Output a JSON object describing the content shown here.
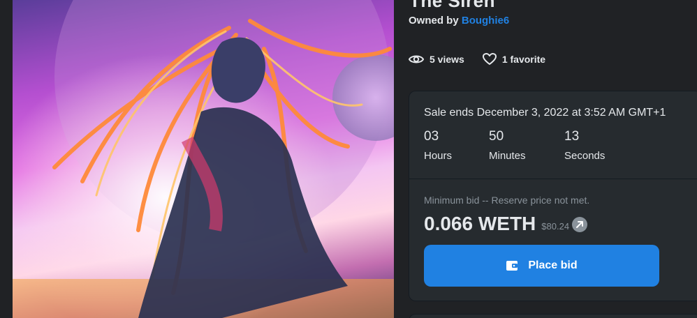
{
  "asset": {
    "title_fragment": "The Siren",
    "owned_by_label": "Owned by",
    "owner": "Boughie6"
  },
  "stats": {
    "views": "5 views",
    "favorites": "1 favorite"
  },
  "sale": {
    "ends_text": "Sale ends December 3, 2022 at 3:52 AM GMT+1",
    "countdown": [
      {
        "value": "03",
        "unit": "Hours"
      },
      {
        "value": "50",
        "unit": "Minutes"
      },
      {
        "value": "13",
        "unit": "Seconds"
      }
    ],
    "min_bid_text": "Minimum bid -- Reserve price not met.",
    "price": "0.066 WETH",
    "usd_price": "$80.24",
    "place_bid_label": "Place bid"
  },
  "icons": {
    "views": "eye-icon",
    "favorites": "heart-icon",
    "usd_link": "arrow-up-right-icon",
    "bid": "wallet-icon"
  },
  "colors": {
    "background": "#202225",
    "card": "#262b2f",
    "accent": "#2081e2",
    "muted_text": "#8a939b"
  }
}
